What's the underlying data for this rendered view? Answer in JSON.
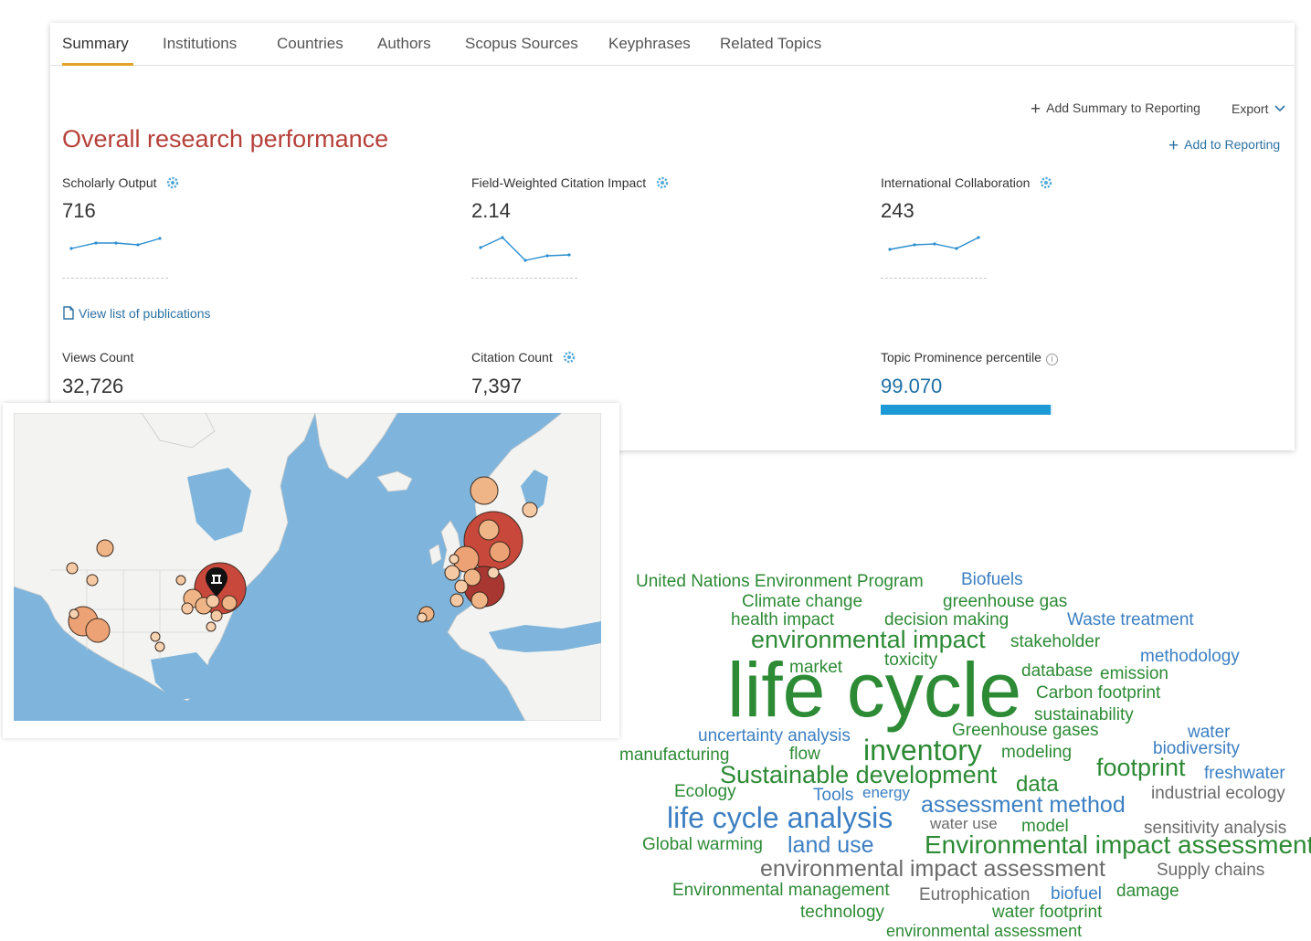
{
  "tabs": [
    "Summary",
    "Institutions",
    "Countries",
    "Authors",
    "Scopus Sources",
    "Keyphrases",
    "Related Topics"
  ],
  "section_title": "Overall research performance",
  "actions": {
    "add_summary": "Add Summary to Reporting",
    "export": "Export",
    "add_reporting": "Add to Reporting"
  },
  "metrics": {
    "scholarly_output": {
      "label": "Scholarly Output",
      "value": "716"
    },
    "fwci": {
      "label": "Field-Weighted Citation Impact",
      "value": "2.14"
    },
    "intl_collab": {
      "label": "International Collaboration",
      "value": "243"
    },
    "views": {
      "label": "Views Count",
      "value": "32,726"
    },
    "citations": {
      "label": "Citation Count",
      "value": "7,397"
    },
    "prominence": {
      "label": "Topic Prominence percentile",
      "value": "99.070",
      "fraction": 0.9907
    }
  },
  "view_list_link": "View list of publications",
  "colors": {
    "accent_title": "#b6403a",
    "link": "#2d72a3",
    "progress": "#1c9ad6",
    "cloud_green": "#2d8a35",
    "cloud_blue": "#3c7fc2",
    "cloud_gray": "#6b6b6b"
  },
  "word_cloud": [
    "United Nations Environment Program",
    "Biofuels",
    "Climate change",
    "greenhouse gas",
    "health impact",
    "decision making",
    "Waste treatment",
    "environmental impact",
    "stakeholder",
    "methodology",
    "market",
    "toxicity",
    "life cycle",
    "database",
    "emission",
    "Carbon footprint",
    "sustainability",
    "Greenhouse gases",
    "water",
    "uncertainty analysis",
    "biodiversity",
    "manufacturing",
    "flow",
    "inventory",
    "modeling",
    "footprint",
    "freshwater",
    "Sustainable development",
    "data",
    "Ecology",
    "Tools",
    "energy",
    "industrial ecology",
    "assessment method",
    "life cycle analysis",
    "water use",
    "model",
    "sensitivity analysis",
    "Global warming",
    "land use",
    "Environmental impact assessment",
    "environmental impact assessment",
    "Supply chains",
    "Environmental management",
    "Eutrophication",
    "biofuel",
    "damage",
    "technology",
    "water footprint",
    "environmental assessment"
  ]
}
